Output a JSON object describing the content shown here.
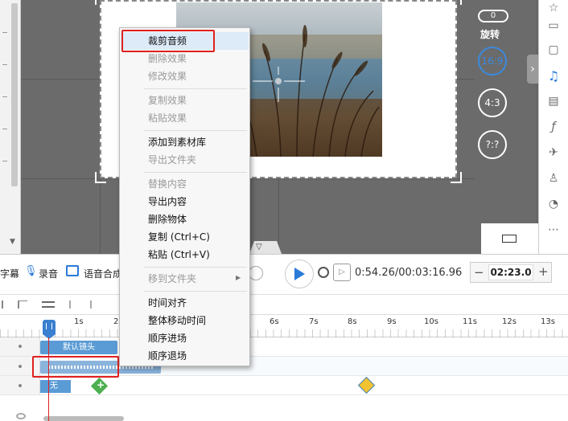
{
  "preview": {
    "rotate_label": "旋转",
    "rotate_value": "0",
    "ratios": [
      {
        "label": "16:9",
        "active": true
      },
      {
        "label": "4:3",
        "active": false
      },
      {
        "label": "?:?",
        "active": false
      }
    ],
    "accent_color": "#3a8ae0"
  },
  "context_menu": {
    "items": [
      {
        "label": "裁剪音频",
        "enabled": true,
        "highlighted": true
      },
      {
        "label": "删除效果",
        "enabled": false
      },
      {
        "label": "修改效果",
        "enabled": false
      },
      {
        "label": "复制效果",
        "enabled": false
      },
      {
        "label": "粘贴效果",
        "enabled": false
      },
      {
        "label": "添加到素材库",
        "enabled": true
      },
      {
        "label": "导出文件夹",
        "enabled": false
      },
      {
        "label": "替换内容",
        "enabled": false
      },
      {
        "label": "导出内容",
        "enabled": true
      },
      {
        "label": "删除物体",
        "enabled": true
      },
      {
        "label": "复制 (Ctrl+C)",
        "enabled": true
      },
      {
        "label": "粘贴 (Ctrl+V)",
        "enabled": true
      },
      {
        "label": "移到文件夹",
        "enabled": false,
        "submenu": true
      },
      {
        "label": "时间对齐",
        "enabled": true
      },
      {
        "label": "整体移动时间",
        "enabled": true
      },
      {
        "label": "顺序进场",
        "enabled": true
      },
      {
        "label": "顺序退场",
        "enabled": true
      }
    ]
  },
  "controls": {
    "subtitle_label": "字幕",
    "record_label": "录音",
    "tts_label": "语音合成",
    "time_display": "0:54.26/00:03:16.96",
    "zoom_value": "02:23.0",
    "minus": "−",
    "plus": "+"
  },
  "timeline": {
    "ruler_ticks": [
      "1s",
      "2s",
      "6s",
      "7s",
      "8s",
      "9s",
      "10s",
      "11s",
      "12s",
      "13s"
    ],
    "camera_clip_label": "默认镜头",
    "none_label": "无"
  },
  "colors": {
    "highlight_red": "#e02020",
    "clip_blue": "#5b9bd5"
  }
}
